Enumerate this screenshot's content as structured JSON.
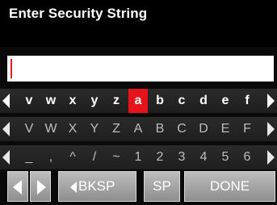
{
  "header": {
    "title": "Enter Security String"
  },
  "input": {
    "value": ""
  },
  "keyboard": {
    "row1": [
      "v",
      "w",
      "x",
      "y",
      "z",
      "a",
      "b",
      "c",
      "d",
      "e",
      "f"
    ],
    "row2": [
      "V",
      "W",
      "X",
      "Y",
      "Z",
      "A",
      "B",
      "C",
      "D",
      "E",
      "F"
    ],
    "row3": [
      "_",
      ",",
      "^",
      "/",
      "~",
      "1",
      "2",
      "3",
      "4",
      "5",
      "6"
    ],
    "selected_key": "a"
  },
  "controls": {
    "backspace_label": "BKSP",
    "space_label": "SP",
    "done_label": "DONE"
  },
  "colors": {
    "selected": "#e8121a",
    "background": "#0a0a0a",
    "button": "#a8a8a8"
  }
}
